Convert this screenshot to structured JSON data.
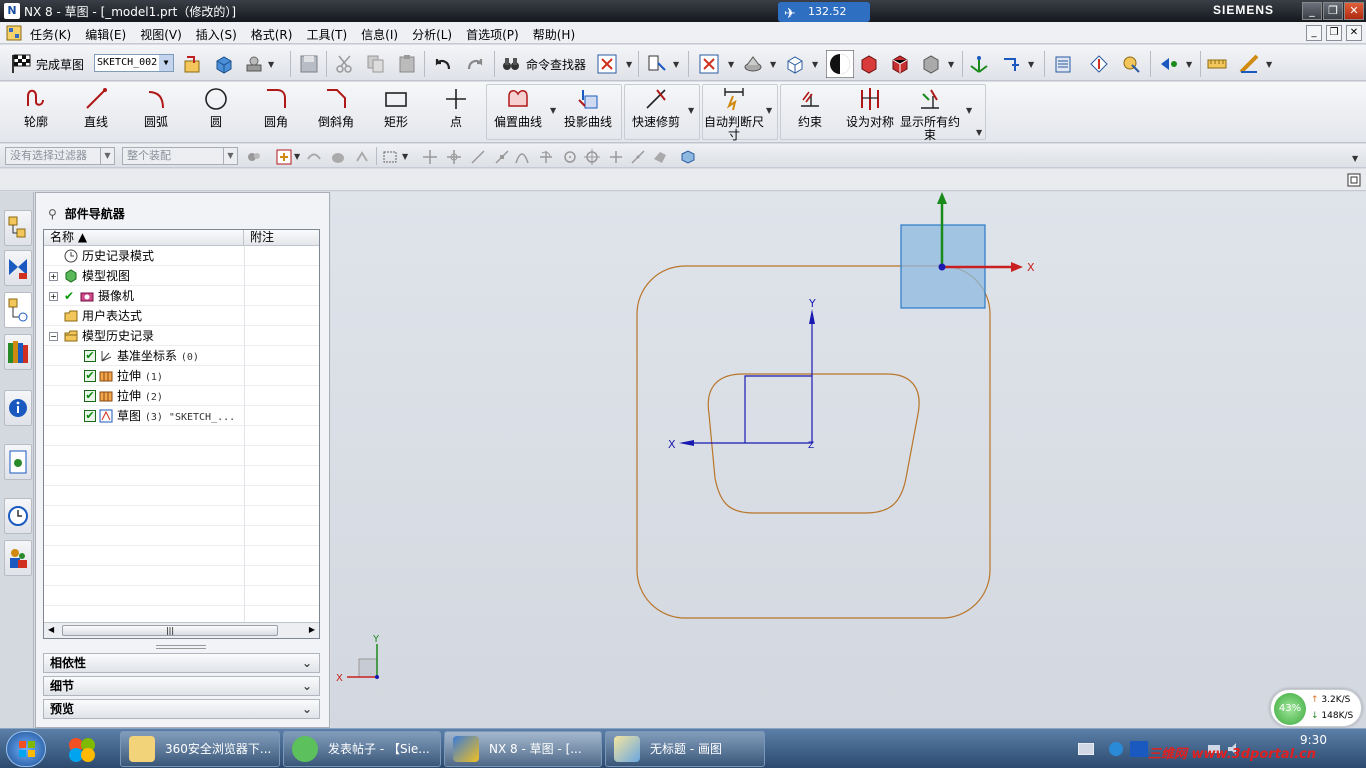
{
  "window": {
    "title": "NX 8 - 草图 - [_model1.prt（修改的）]",
    "brand": "SIEMENS",
    "speed": "132.52 KB/s"
  },
  "menu": {
    "items": [
      "任务(K)",
      "编辑(E)",
      "视图(V)",
      "插入(S)",
      "格式(R)",
      "工具(T)",
      "信息(I)",
      "分析(L)",
      "首选项(P)",
      "帮助(H)"
    ]
  },
  "toolbar1": {
    "finish_sketch": "完成草图",
    "sketch_name": "SKETCH_002",
    "command_finder": "命令查找器"
  },
  "sketch_tools": [
    {
      "label": "轮廓"
    },
    {
      "label": "直线"
    },
    {
      "label": "圆弧"
    },
    {
      "label": "圆"
    },
    {
      "label": "圆角"
    },
    {
      "label": "倒斜角"
    },
    {
      "label": "矩形"
    },
    {
      "label": "点"
    },
    {
      "label": "偏置曲线"
    },
    {
      "label": "投影曲线"
    },
    {
      "label": "快速修剪"
    },
    {
      "label": "自动判断尺寸"
    },
    {
      "label": "约束"
    },
    {
      "label": "设为对称"
    },
    {
      "label": "显示所有约束"
    }
  ],
  "selection": {
    "filter": "没有选择过滤器",
    "scope": "整个装配"
  },
  "navigator": {
    "title": "部件导航器",
    "col_name": "名称",
    "col_note": "附注",
    "rows": [
      {
        "label": "历史记录模式",
        "extra": ""
      },
      {
        "label": "模型视图",
        "extra": ""
      },
      {
        "label": "摄像机",
        "extra": ""
      },
      {
        "label": "用户表达式",
        "extra": ""
      },
      {
        "label": "模型历史记录",
        "extra": ""
      },
      {
        "label": "基准坐标系",
        "extra": "(0)"
      },
      {
        "label": "拉伸",
        "extra": "(1)"
      },
      {
        "label": "拉伸",
        "extra": "(2)"
      },
      {
        "label": "草图",
        "extra": "(3) \"SKETCH_..."
      }
    ],
    "panels": [
      "相依性",
      "细节",
      "预览"
    ]
  },
  "canvas": {
    "axis_x": "X",
    "axis_y": "Y",
    "axis_z": "Z",
    "colors": {
      "background": "#d9dde4",
      "curve": "#b8762a",
      "sketch_axis": "#1a1ab0",
      "datum_plane": "#8db9e0"
    }
  },
  "taskbar": {
    "tasks": [
      "360安全浏览器下...",
      "发表帖子 - 【Sie...",
      "NX 8 - 草图 - [...",
      "无标题 - 画图"
    ],
    "clock": "9:30",
    "watermark": "三维网 www.3dportal.cn"
  },
  "netmeter": {
    "percent": "43%",
    "up": "3.2K/S",
    "down": "148K/S"
  }
}
